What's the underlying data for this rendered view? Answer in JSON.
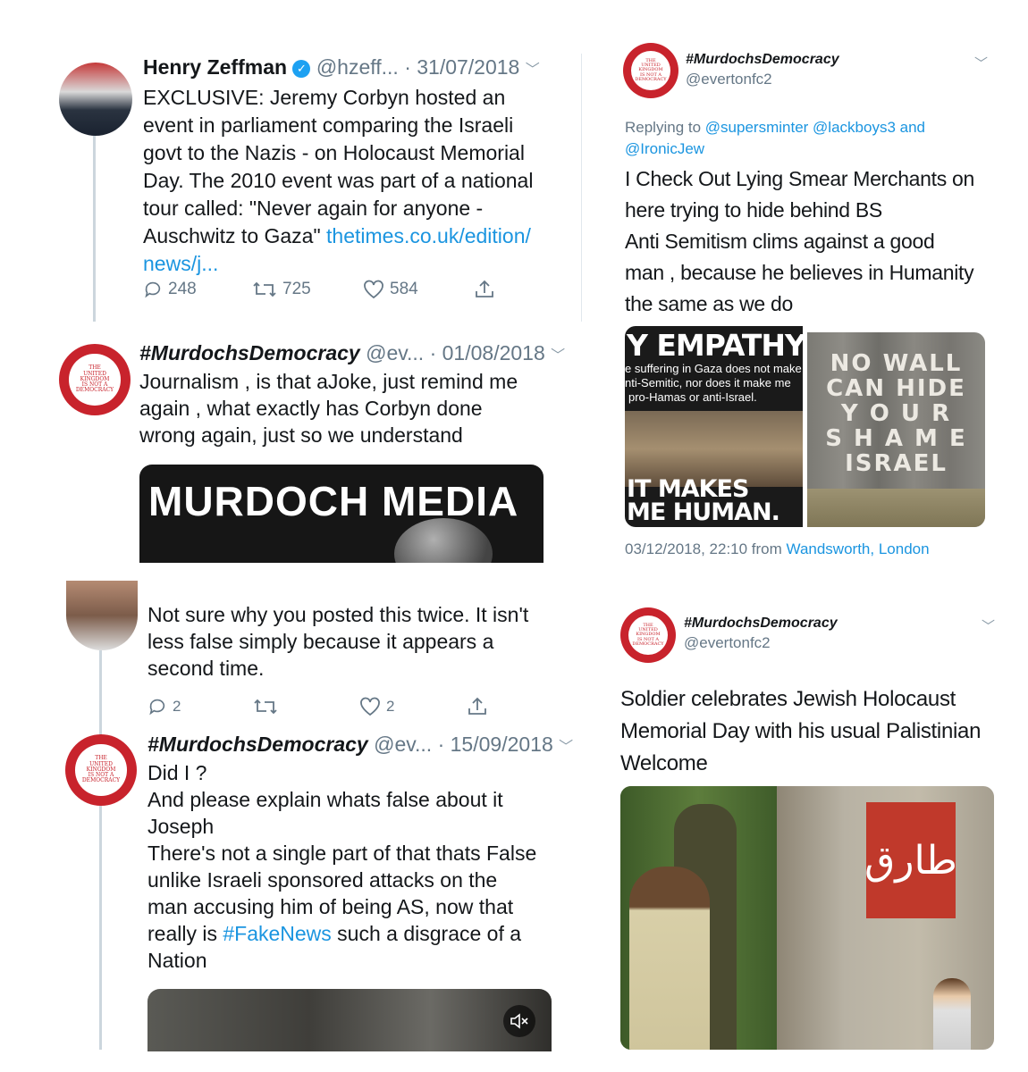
{
  "t1": {
    "name": "Henry Zeffman",
    "handle": "@hzeff...",
    "date": "· 31/07/2018",
    "lines": [
      "EXCLUSIVE: Jeremy Corbyn hosted an",
      "event in parliament comparing the Israeli",
      "govt to the Nazis - on Holocaust Memorial",
      "Day. The 2010 event was part of a national",
      "tour called: \"Never again for anyone -"
    ],
    "line6_text": "Auschwitz to Gaza\" ",
    "link1": "thetimes.co.uk/edition/",
    "link2": "news/j...",
    "replies": "248",
    "retweets": "725",
    "likes": "584"
  },
  "t2": {
    "name": "#MurdochsDemocracy",
    "handle": "@ev...",
    "date": "· 01/08/2018",
    "lines": [
      "Journalism , is that aJoke, just remind me",
      "again , what exactly has Corbyn done",
      "wrong again, just so we understand"
    ],
    "media_text": "MURDOCH MEDIA"
  },
  "t3": {
    "name": "#MurdochsDemocracy",
    "handle": "@evertonfc2",
    "replying_label": "Replying to",
    "mention1": "@supersminter",
    "mention2": "@lackboys3",
    "and": "and",
    "mention3": "@IronicJew",
    "lines": [
      "I Check Out Lying Smear Merchants on",
      "here trying to hide behind BS",
      "Anti Semitism clims against a good",
      "man , because he believes in Humanity",
      "the same as we do"
    ],
    "poster1": {
      "title": "Y EMPATHY",
      "sub1": "e suffering in Gaza does not make",
      "sub2": "nti-Semitic, nor does it make me",
      "sub3": "pro-Hamas or anti-Israel.",
      "bottom1": "IT MAKES",
      "bottom2": "ME HUMAN."
    },
    "poster2": [
      "NO WALL",
      "CAN HIDE",
      "Y O U R",
      "S H A M E",
      "ISRAEL"
    ],
    "timestamp": "03/12/2018, 22:10 from",
    "location": "Wandsworth, London"
  },
  "t4": {
    "lines": [
      "Not sure why you posted this twice. It isn't",
      "less false simply because it appears a",
      "second time."
    ],
    "replies": "2",
    "likes": "2"
  },
  "t5": {
    "name": "#MurdochsDemocracy",
    "handle": "@ev...",
    "date": "· 15/09/2018",
    "lines": [
      "Did I ?",
      "And please explain whats false about it",
      "Joseph",
      "There's not a single part of that thats False",
      "unlike Israeli sponsored attacks on the",
      "man accusing him of being AS, now that"
    ],
    "line7_pre": "really is ",
    "hashtag": "#FakeNews",
    "line7_post": " such a disgrace of a",
    "line8": "Nation"
  },
  "t6": {
    "name": "#MurdochsDemocracy",
    "handle": "@evertonfc2",
    "lines": [
      "Soldier celebrates Jewish Holocaust",
      "Memorial Day with his usual Palistinian",
      "Welcome"
    ],
    "graffiti": "طارق"
  },
  "avatar_badge": [
    "THE",
    "UNITED",
    "KINGDOM",
    "IS NOT A",
    "DEMOCRACY"
  ]
}
